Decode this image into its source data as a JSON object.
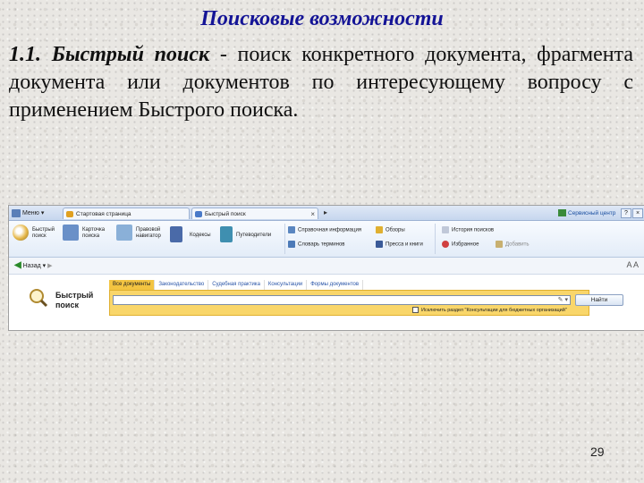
{
  "slide": {
    "title": "Поисковые возможности",
    "lead": "1.1. Быстрый поиск",
    "body": " - поиск конкретного документа, фрагмента документа или документов по интересующему вопросу с применением Быстрого поиска.",
    "page_number": "29"
  },
  "app": {
    "menu_label": "Меню",
    "tabs": [
      {
        "label": "Стартовая страница"
      },
      {
        "label": "Быстрый поиск"
      }
    ],
    "service_center": "Сервисный центр",
    "ribbon": {
      "quick_search": "Быстрый поиск",
      "card_search": "Карточка поиска",
      "legal_navigator": "Правовой навигатор",
      "codexes": "Кодексы",
      "guides": "Путеводители",
      "reference_info": "Справочная информация",
      "term_dictionary": "Словарь терминов",
      "reviews": "Обзоры",
      "press_books": "Пресса и книги",
      "search_history": "История поисков",
      "favorites": "Избранное",
      "add": "Добавить"
    },
    "nav": {
      "back_label": "Назад",
      "font_size_label": "A A"
    },
    "search": {
      "panel_title": "Быстрый поиск",
      "tabs": [
        "Все документы",
        "Законодательство",
        "Судебная практика",
        "Консультации",
        "Формы документов"
      ],
      "input_value": "",
      "find_button": "Найти",
      "exclude_label": "Исключить раздел \"Консультации для бюджетных организаций\""
    }
  }
}
